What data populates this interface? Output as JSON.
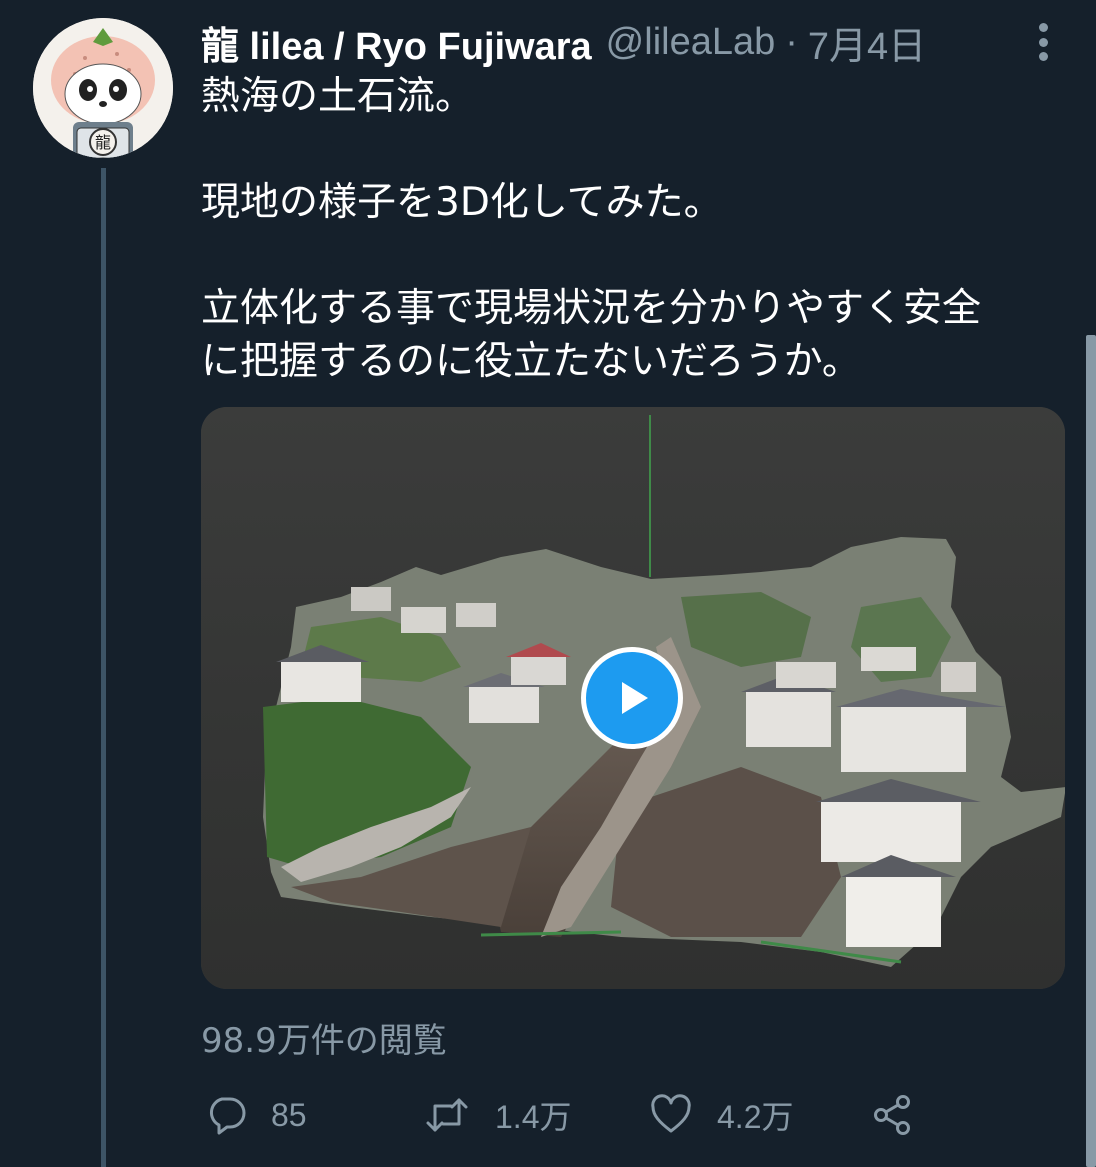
{
  "author": {
    "display_name": "龍 lilea / Ryo Fujiwara",
    "handle": "@lileaLab",
    "separator": "·",
    "date": "7月4日",
    "avatar_text": "龍"
  },
  "tweet": {
    "lines": [
      "熱海の土石流。",
      "",
      "現地の様子を3D化してみた。",
      "",
      "立体化する事で現場状況を分かりやすく安全",
      "に把握するのに役立たないだろうか。"
    ]
  },
  "media": {
    "type": "video",
    "play_icon": "play-icon"
  },
  "views": "98.9万件の閲覧",
  "actions": {
    "reply": {
      "icon": "reply-icon",
      "count": "85"
    },
    "retweet": {
      "icon": "retweet-icon",
      "count": "1.4万"
    },
    "like": {
      "icon": "heart-icon",
      "count": "4.2万"
    },
    "share": {
      "icon": "share-icon"
    }
  },
  "colors": {
    "background": "#15202b",
    "text": "#ffffff",
    "secondary": "#8899a6",
    "accent": "#1d9bf0",
    "thread_line": "#3d5466"
  }
}
